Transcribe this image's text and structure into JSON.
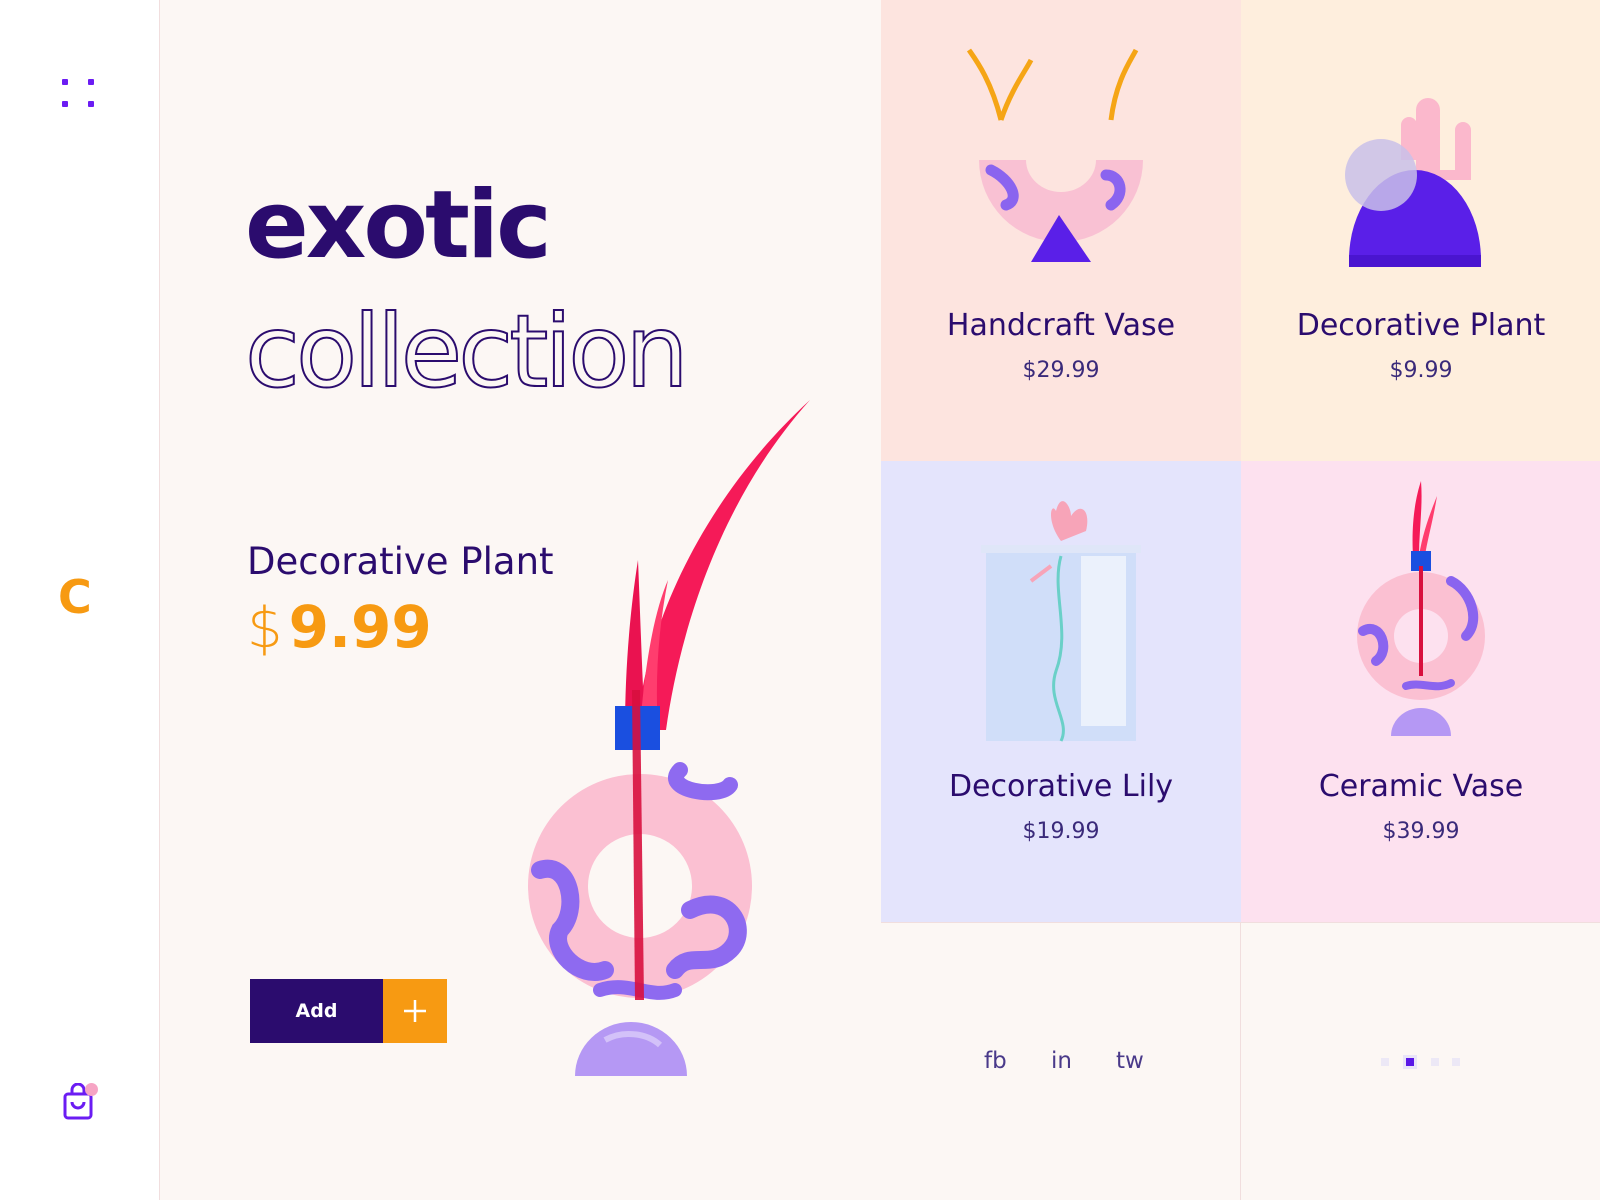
{
  "sidebar": {
    "brand_letter": "C",
    "icons": [
      "grid-menu-icon",
      "shopping-bag-icon"
    ]
  },
  "hero": {
    "title_line1": "exotic",
    "title_line2": "collection",
    "product_name": "Decorative Plant",
    "currency": "$",
    "price": "9.99",
    "add_label": "Add"
  },
  "products": [
    {
      "name": "Handcraft Vase",
      "price": "$29.99"
    },
    {
      "name": "Decorative Plant",
      "price": "$9.99"
    },
    {
      "name": "Decorative Lily",
      "price": "$19.99"
    },
    {
      "name": "Ceramic Vase",
      "price": "$39.99"
    }
  ],
  "social": [
    "fb",
    "in",
    "tw"
  ],
  "pagination": {
    "total": 4,
    "active": 2
  },
  "colors": {
    "primary": "#2b0c6e",
    "accent": "#f79a12",
    "violet": "#6b1cf3",
    "hero_bg": "#fcf7f4",
    "tile_1": "#fde4df",
    "tile_2": "#feeedd",
    "tile_3": "#e4e4fc",
    "tile_4": "#fde1ef"
  }
}
